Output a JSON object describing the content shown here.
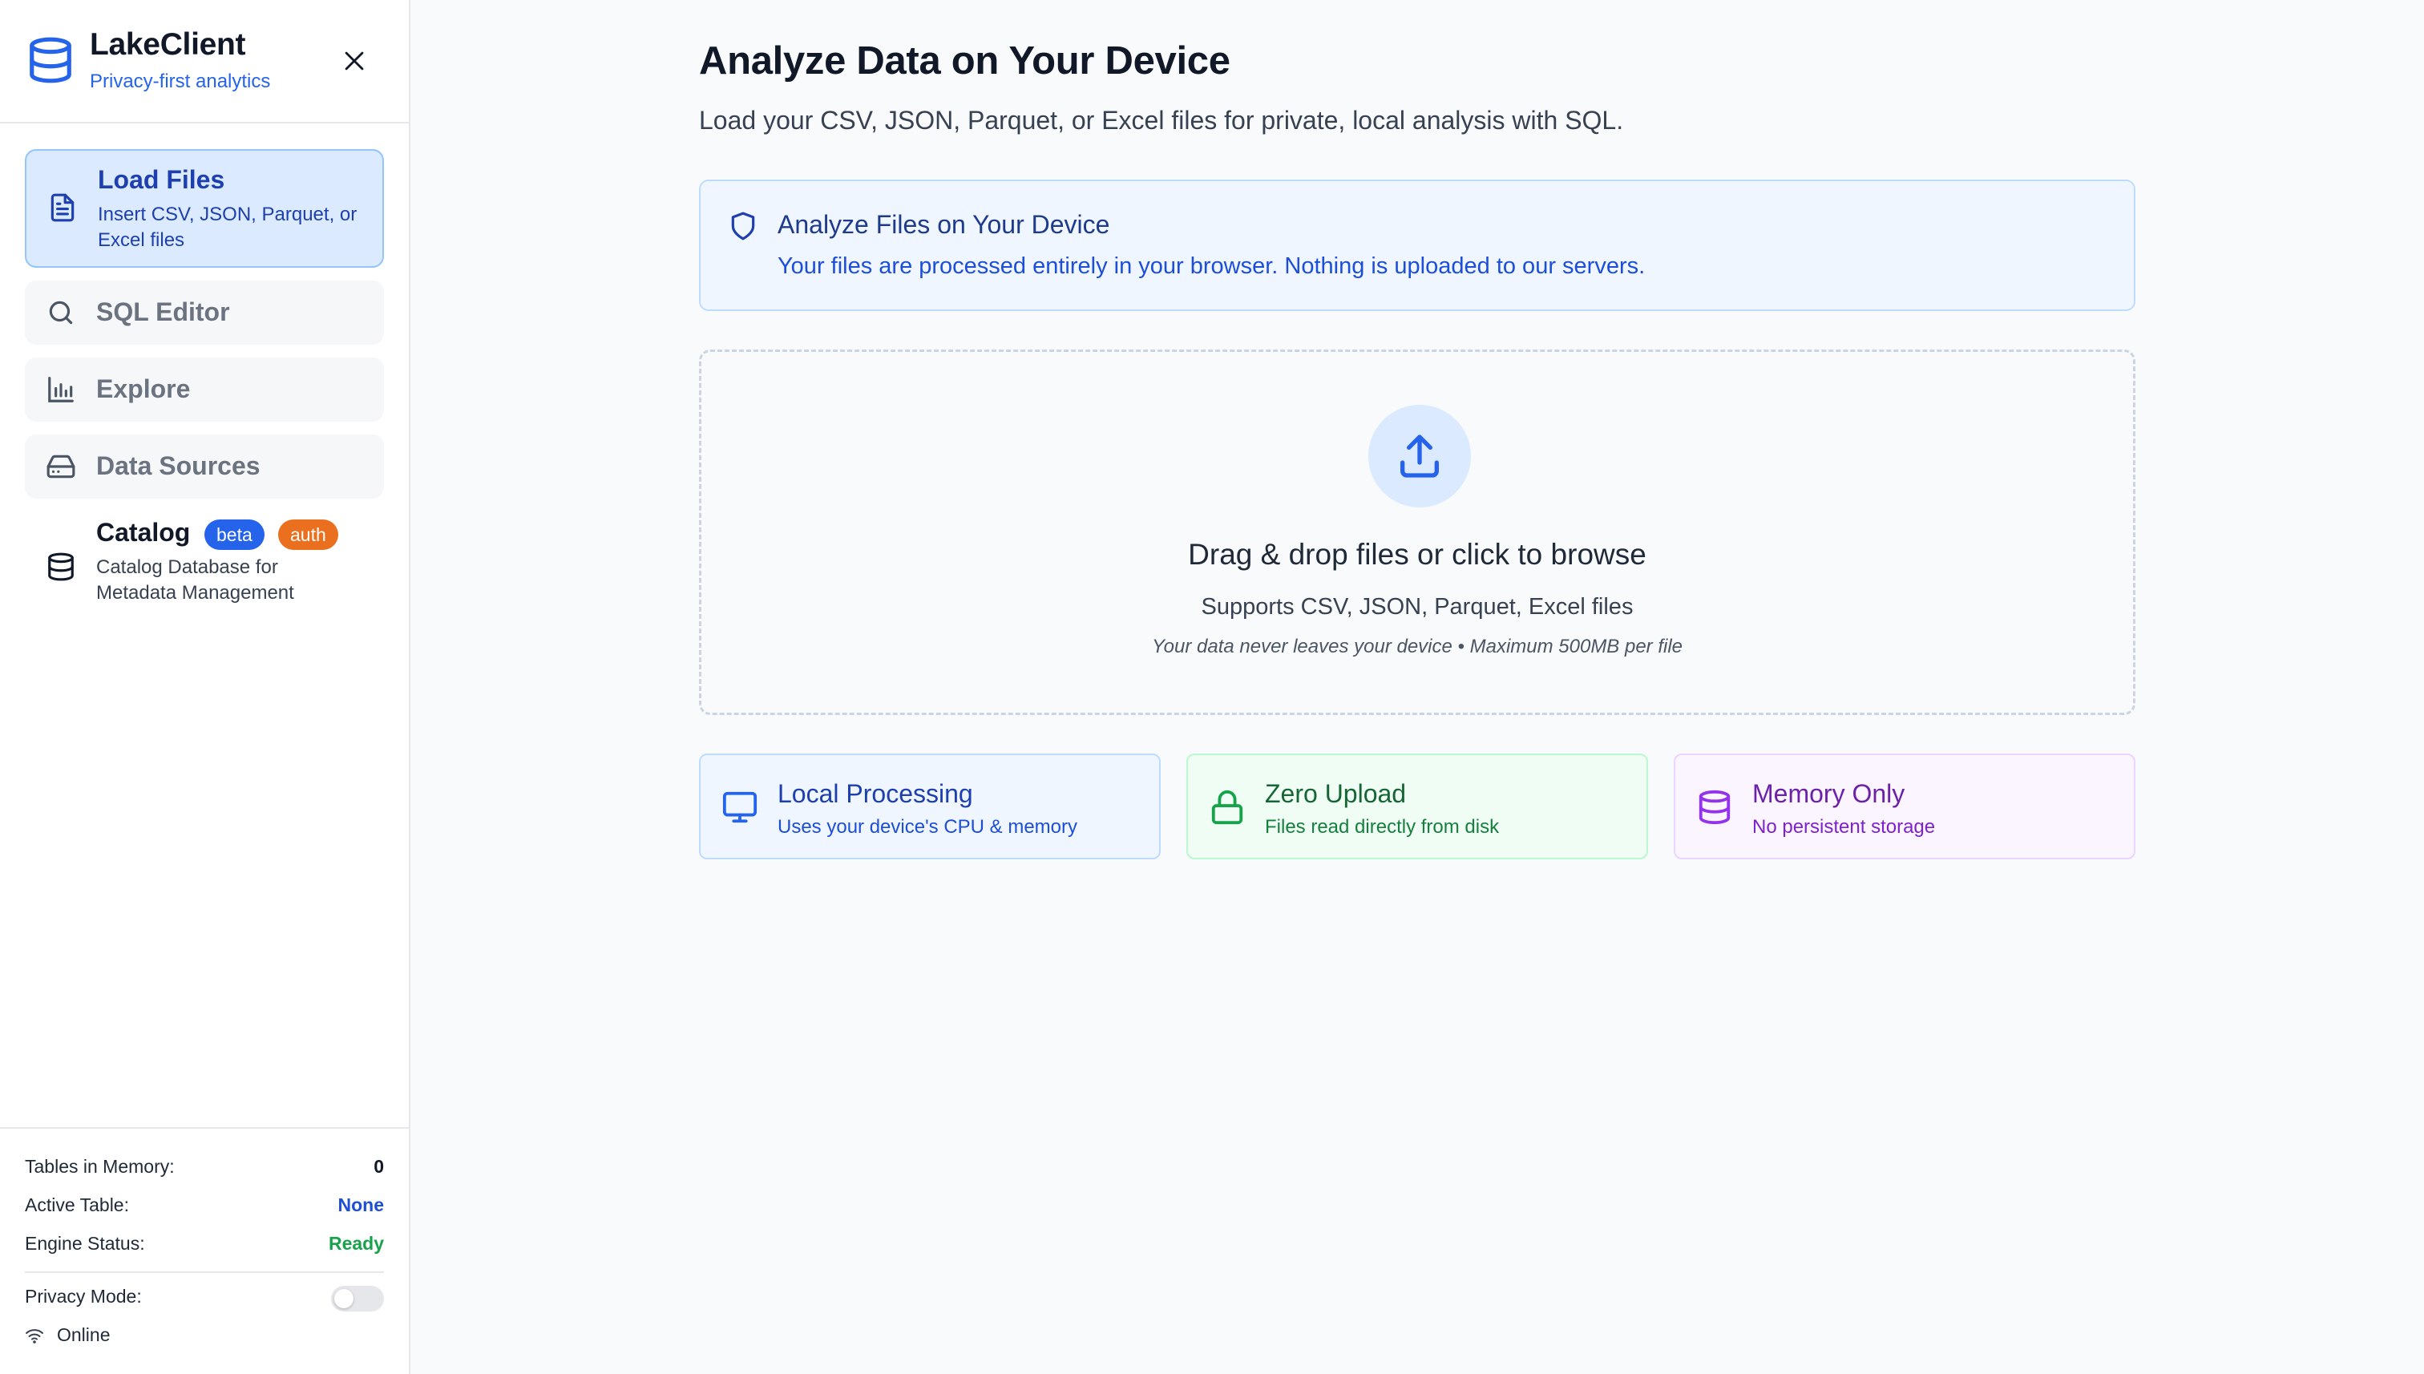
{
  "colors": {
    "accent": "#2563eb",
    "active_bg": "#dbeafe",
    "ready": "#16a34a",
    "badge_beta": "#2563eb",
    "badge_auth": "#ea6f1e"
  },
  "sidebar": {
    "brand": {
      "title": "LakeClient",
      "subtitle": "Privacy-first analytics",
      "icon": "database-icon"
    },
    "close_icon": "close-icon",
    "nav": [
      {
        "label": "Load Files",
        "desc": "Insert CSV, JSON, Parquet, or Excel files",
        "icon": "file-icon",
        "active": true
      },
      {
        "label": "SQL Editor",
        "icon": "search-icon"
      },
      {
        "label": "Explore",
        "icon": "bar-chart-icon"
      },
      {
        "label": "Data Sources",
        "icon": "hard-drive-icon"
      },
      {
        "label": "Catalog",
        "desc": "Catalog Database for Metadata Management",
        "icon": "database-icon",
        "badges": [
          "beta",
          "auth"
        ]
      }
    ],
    "footer": {
      "tables_label": "Tables in Memory:",
      "tables_value": "0",
      "active_label": "Active Table:",
      "active_value": "None",
      "engine_label": "Engine Status:",
      "engine_value": "Ready",
      "privacy_label": "Privacy Mode:",
      "privacy_on": false,
      "online_label": "Online"
    }
  },
  "main": {
    "title": "Analyze Data on Your Device",
    "subtitle": "Load your CSV, JSON, Parquet, or Excel files for private, local analysis with SQL.",
    "info": {
      "title": "Analyze Files on Your Device",
      "text": "Your files are processed entirely in your browser. Nothing is uploaded to our servers.",
      "icon": "shield-icon"
    },
    "dropzone": {
      "title": "Drag & drop files or click to browse",
      "subtitle": "Supports CSV, JSON, Parquet, Excel files",
      "note": "Your data never leaves your device • Maximum 500MB per file",
      "icon": "upload-icon"
    },
    "features": [
      {
        "title": "Local Processing",
        "desc": "Uses your device's CPU & memory",
        "icon": "monitor-icon"
      },
      {
        "title": "Zero Upload",
        "desc": "Files read directly from disk",
        "icon": "lock-icon"
      },
      {
        "title": "Memory Only",
        "desc": "No persistent storage",
        "icon": "database-icon"
      }
    ]
  }
}
